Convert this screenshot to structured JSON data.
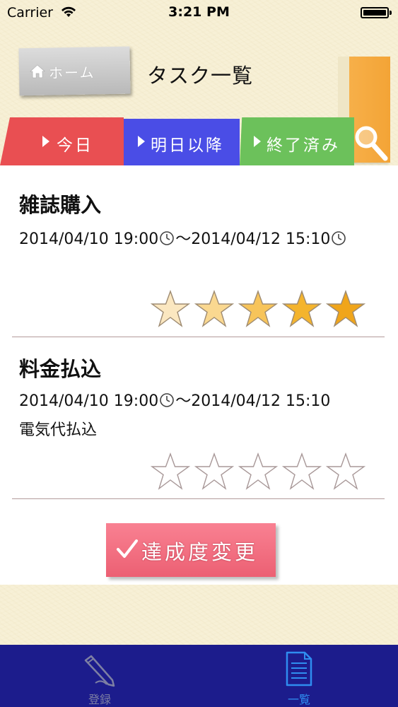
{
  "status_bar": {
    "carrier": "Carrier",
    "time": "3:21 PM"
  },
  "header": {
    "home_label": "ホーム",
    "title": "タスク一覧"
  },
  "tabs": [
    {
      "label": "今日",
      "color": "#e94f52"
    },
    {
      "label": "明日以降",
      "color": "#4a4de6"
    },
    {
      "label": "終了済み",
      "color": "#6cc15b"
    }
  ],
  "icons": {
    "home": "home-icon",
    "search": "search-icon",
    "clock": "clock-icon",
    "star": "star-icon",
    "pen": "pen-icon",
    "document": "document-icon"
  },
  "tasks": [
    {
      "title": "雑誌購入",
      "start": "2014/04/10 19:00",
      "separator": "～",
      "end": "2014/04/12 15:10",
      "memo": "",
      "rating": 5,
      "star_style": "gradient-filled"
    },
    {
      "title": "料金払込",
      "start": "2014/04/10 19:00",
      "separator": "～",
      "end": "2014/04/12 15:10",
      "memo": "電気代払込",
      "rating": 0,
      "star_style": "outline"
    }
  ],
  "achieve_button": {
    "label": "達成度変更"
  },
  "tab_bar": {
    "items": [
      {
        "label": "登録",
        "selected": false
      },
      {
        "label": "一覧",
        "selected": true
      }
    ]
  }
}
